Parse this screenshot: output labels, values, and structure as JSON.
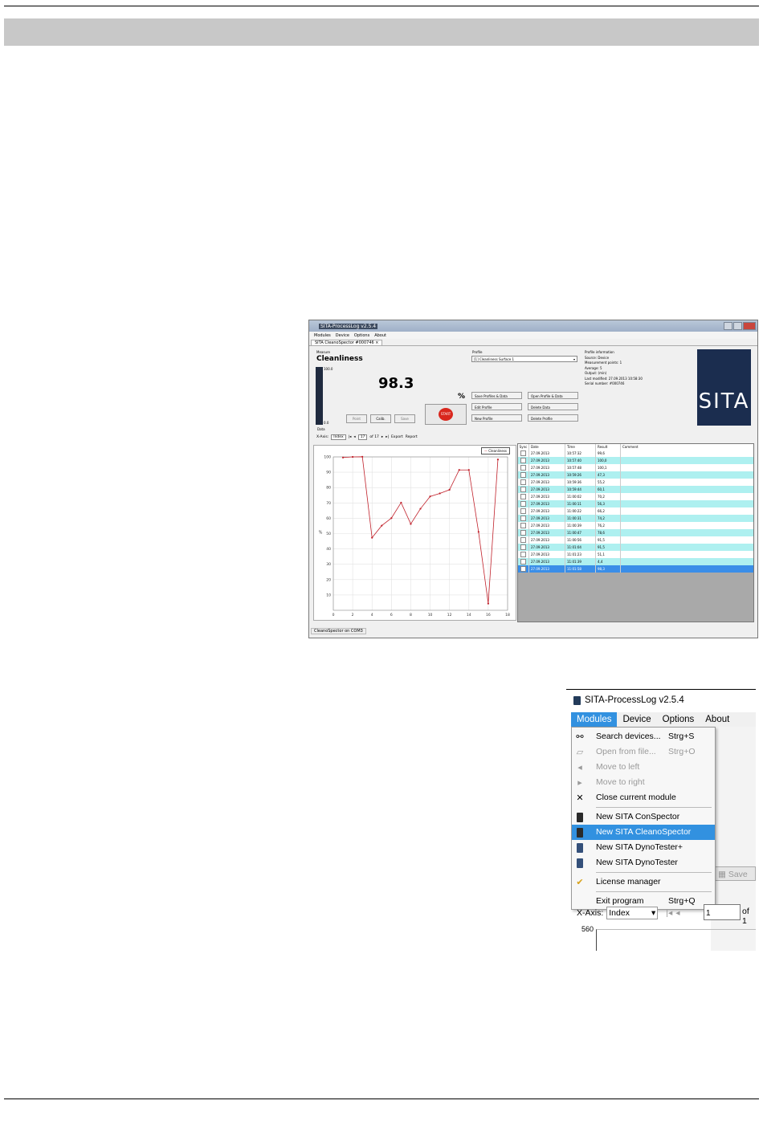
{
  "shot1": {
    "window_title": "SITA-ProcessLog v2.5.4",
    "menu": [
      "Modules",
      "Device",
      "Options",
      "About"
    ],
    "tab_label": "SITA CleanoSpector #000746",
    "measure_caption": "Measure",
    "measure_title": "Cleanliness",
    "bar_max": "100.0",
    "bar_min": "0.0",
    "value": "98.3",
    "unit": "%",
    "buttons": {
      "point": "Point",
      "calib": "Calib.",
      "save": "Save",
      "start": "START"
    },
    "data_label": "Data",
    "profile_caption": "Profile",
    "profile_selected": "[1] Cleanliness Surface 1",
    "profile_buttons": {
      "save_profiles": "Save Profiles & Data",
      "open_profile": "Open Profile & Data",
      "edit_profile": "Edit Profile",
      "delete_data": "Delete Data",
      "new_profile": "New Profile",
      "delete_profile": "Delete Profile"
    },
    "profile_info": {
      "caption": "Profile information",
      "source": "Source: Device",
      "points": "Measurement points: 1",
      "average": "Average: 5",
      "output": "Output: (min)",
      "modified": "Last modified: 27.09.2013 10:58:30",
      "serial": "Serial number: #000746"
    },
    "logo_text": "SITA",
    "xaxis": {
      "label": "X-Axis:",
      "select": "Index",
      "page": "17",
      "of": "of 17",
      "export": "Export",
      "report": "Report"
    },
    "legend": "Cleanliness",
    "table": {
      "headers": [
        "Sync",
        "Date",
        "Time",
        "Result",
        "Comment"
      ],
      "rows": [
        {
          "date": "27.09.2013",
          "time": "10:57:32",
          "result": "99,6"
        },
        {
          "date": "27.09.2013",
          "time": "10:57:40",
          "result": "100,0"
        },
        {
          "date": "27.09.2013",
          "time": "10:57:48",
          "result": "100,1"
        },
        {
          "date": "27.09.2013",
          "time": "10:59:26",
          "result": "47,3"
        },
        {
          "date": "27.09.2013",
          "time": "10:59:36",
          "result": "55,2"
        },
        {
          "date": "27.09.2013",
          "time": "10:59:44",
          "result": "60,1"
        },
        {
          "date": "27.09.2013",
          "time": "11:00:02",
          "result": "70,2"
        },
        {
          "date": "27.09.2013",
          "time": "11:00:11",
          "result": "56,3"
        },
        {
          "date": "27.09.2013",
          "time": "11:00:22",
          "result": "66,2"
        },
        {
          "date": "27.09.2013",
          "time": "11:00:31",
          "result": "74,2"
        },
        {
          "date": "27.09.2013",
          "time": "11:00:39",
          "result": "76,2"
        },
        {
          "date": "27.09.2013",
          "time": "11:00:47",
          "result": "78,6"
        },
        {
          "date": "27.09.2013",
          "time": "11:00:56",
          "result": "91,5"
        },
        {
          "date": "27.09.2013",
          "time": "11:01:04",
          "result": "91,5"
        },
        {
          "date": "27.09.2013",
          "time": "11:01:23",
          "result": "51,1"
        },
        {
          "date": "27.09.2013",
          "time": "11:01:39",
          "result": "4,4"
        },
        {
          "date": "27.09.2013",
          "time": "11:01:58",
          "result": "98,3"
        }
      ]
    },
    "status": "CleanoSpector on COM3"
  },
  "chart_data": {
    "type": "line",
    "x": [
      1,
      2,
      3,
      4,
      5,
      6,
      7,
      8,
      9,
      10,
      11,
      12,
      13,
      14,
      15,
      16,
      17
    ],
    "series": [
      {
        "name": "Cleanliness",
        "values": [
          99.6,
          100.0,
          100.1,
          47.3,
          55.2,
          60.1,
          70.2,
          56.3,
          66.2,
          74.2,
          76.2,
          78.6,
          91.5,
          91.5,
          51.1,
          4.4,
          98.3
        ]
      }
    ],
    "ylabel": "%",
    "ylim": [
      0,
      100
    ],
    "xlim": [
      0,
      18
    ],
    "yticks": [
      "10",
      "20",
      "30",
      "40",
      "50",
      "60",
      "70",
      "80",
      "90",
      "100"
    ],
    "xticks": [
      "0",
      "2",
      "4",
      "6",
      "8",
      "10",
      "12",
      "14",
      "16",
      "18"
    ],
    "grid": true,
    "legend": "top-right",
    "color": "#c0202a"
  },
  "shot2": {
    "window_title": "SITA-ProcessLog v2.5.4",
    "menu": [
      "Modules",
      "Device",
      "Options",
      "About"
    ],
    "items": [
      {
        "icon": "binoculars-icon",
        "label": "Search devices...",
        "shortcut": "Strg+S",
        "disabled": false
      },
      {
        "icon": "open-file-icon",
        "label": "Open from file...",
        "shortcut": "Strg+O",
        "disabled": true
      },
      {
        "icon": "arrow-left-icon",
        "label": "Move to left",
        "shortcut": "",
        "disabled": true
      },
      {
        "icon": "arrow-right-icon",
        "label": "Move to right",
        "shortcut": "",
        "disabled": true
      },
      {
        "icon": "close-icon",
        "label": "Close current module",
        "shortcut": "",
        "disabled": false
      },
      {
        "icon": "conspector-device-icon",
        "label": "New SITA ConSpector",
        "shortcut": "",
        "disabled": false
      },
      {
        "icon": "cleanospector-device-icon",
        "label": "New SITA CleanoSpector",
        "shortcut": "",
        "disabled": false,
        "highlighted": true
      },
      {
        "icon": "dynotester-plus-device-icon",
        "label": "New SITA DynoTester+",
        "shortcut": "",
        "disabled": false
      },
      {
        "icon": "dynotester-device-icon",
        "label": "New SITA DynoTester",
        "shortcut": "",
        "disabled": false
      },
      {
        "icon": "license-icon",
        "label": "License manager",
        "shortcut": "",
        "disabled": false
      },
      {
        "icon": "",
        "label": "Exit program",
        "shortcut": "Strg+Q",
        "disabled": false
      }
    ],
    "save_label": "Save",
    "xaxis_label": "X-Axis:",
    "xaxis_select": "Index",
    "page_value": "1",
    "of_text": "of 1",
    "y_tick": "560",
    "highlight_color": "#3291e0"
  }
}
